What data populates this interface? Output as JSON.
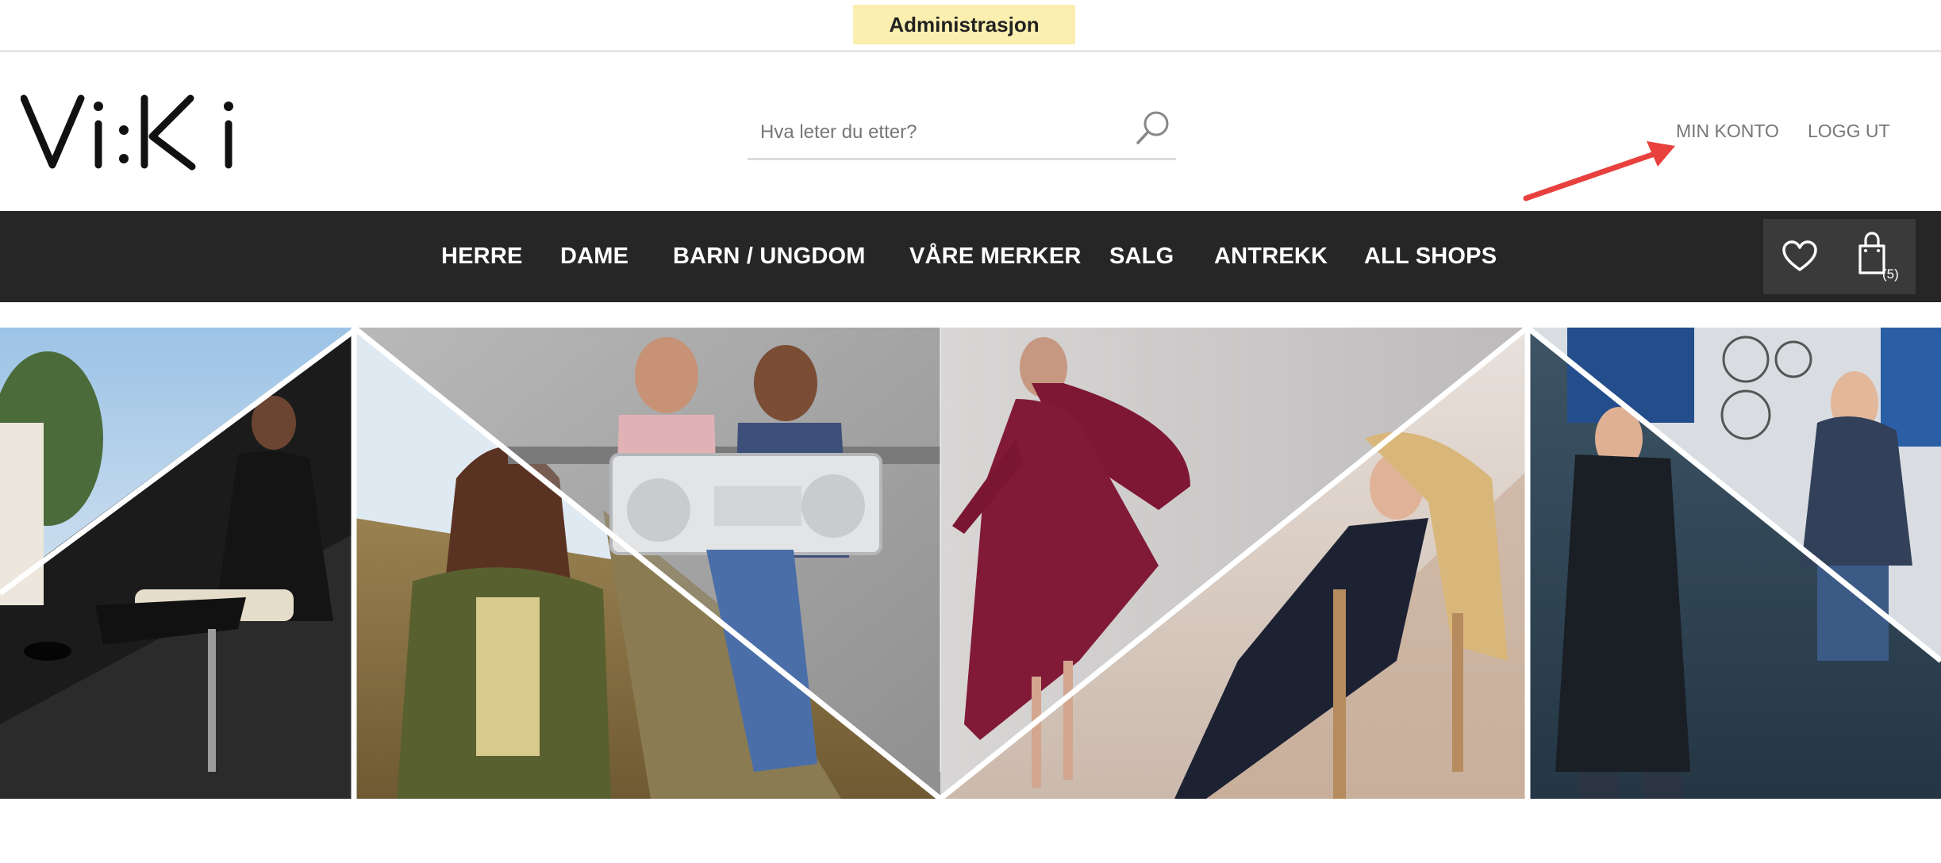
{
  "admin": {
    "label": "Administrasjon"
  },
  "header": {
    "logo_text": "Vi:Ki",
    "search": {
      "placeholder": "Hva leter du etter?",
      "value": ""
    },
    "account": {
      "my_account": "MIN KONTO",
      "logout": "LOGG UT"
    }
  },
  "nav": {
    "items": [
      {
        "label": "HERRE"
      },
      {
        "label": "DAME"
      },
      {
        "label": "BARN / UNGDOM"
      },
      {
        "label": "VÅRE MERKER"
      },
      {
        "label": "SALG"
      },
      {
        "label": "ANTREKK"
      },
      {
        "label": "ALL SHOPS"
      }
    ],
    "icons": {
      "wishlist": "heart-icon",
      "cart": "shopping-bag-icon"
    },
    "cart_count": "(5)"
  },
  "colors": {
    "nav_background": "#262626",
    "admin_background": "#fbefb0",
    "annotation_arrow": "#e8413d"
  }
}
